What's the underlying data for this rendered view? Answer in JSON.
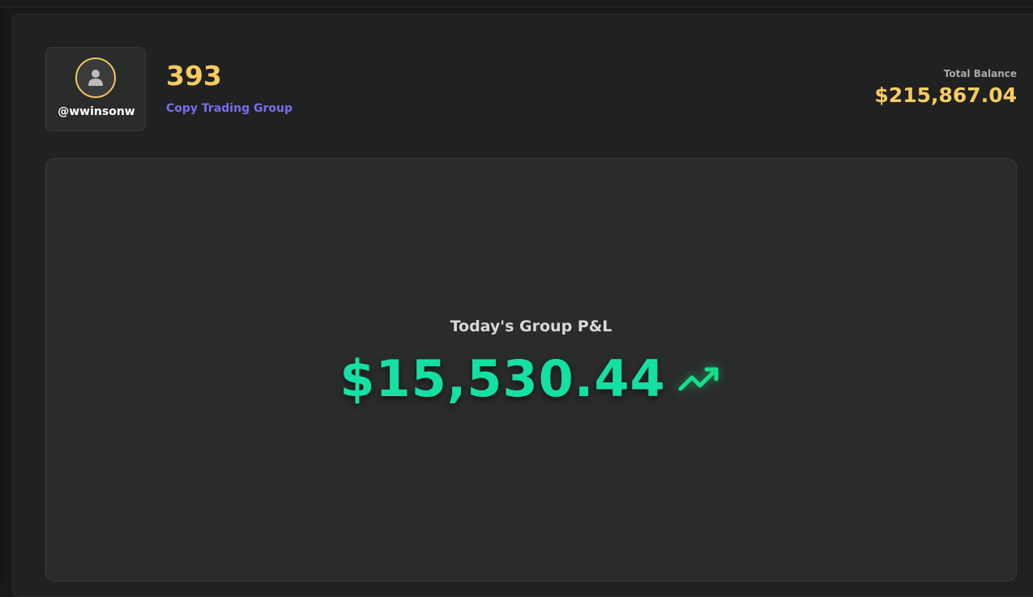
{
  "profile": {
    "handle": "@wwinsonw",
    "avatar_icon": "user-icon",
    "avatar_ring_color": "#f2c660"
  },
  "group": {
    "count": "393",
    "label": "Copy Trading Group"
  },
  "balance": {
    "label": "Total Balance",
    "value": "$215,867.04"
  },
  "pnl": {
    "label": "Today's Group P&L",
    "value": "$15,530.44",
    "trend_icon": "trending-up-icon",
    "trend": "up",
    "color": "#14e0a4"
  },
  "colors": {
    "accent_gold": "#f6cc5f",
    "accent_purple": "#7b6cf0",
    "positive_green": "#14e0a4"
  }
}
